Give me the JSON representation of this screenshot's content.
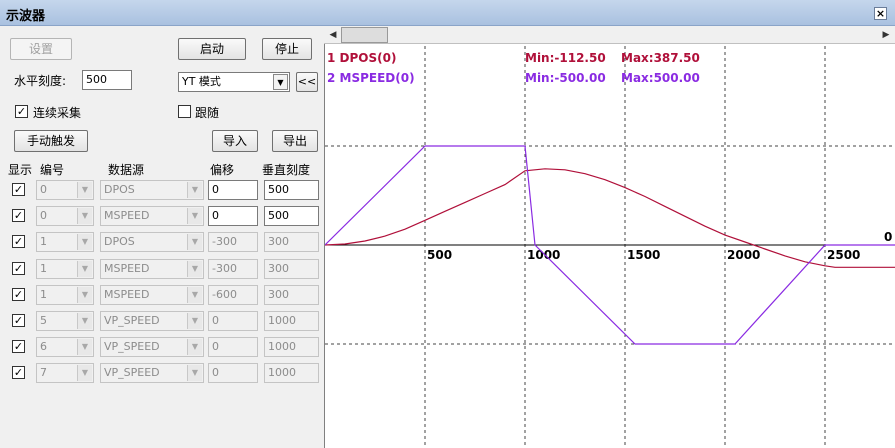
{
  "window": {
    "title": "示波器",
    "close_glyph": "×"
  },
  "controls": {
    "setup_label": "设置",
    "start_label": "启动",
    "stop_label": "停止",
    "hscale_label": "水平刻度:",
    "hscale_value": "500",
    "mode_value": "YT 模式",
    "collapse_label": "<<",
    "continuous_label": "连续采集",
    "continuous_checked": true,
    "follow_label": "跟随",
    "follow_checked": false,
    "manual_trigger_label": "手动触发",
    "import_label": "导入",
    "export_label": "导出"
  },
  "table": {
    "headers": {
      "show": "显示",
      "num": "编号",
      "source": "数据源",
      "offset": "偏移",
      "vscale": "垂直刻度"
    },
    "rows": [
      {
        "show": true,
        "num": "0",
        "source": "DPOS",
        "offset": "0",
        "vscale": "500",
        "enabled": true
      },
      {
        "show": true,
        "num": "0",
        "source": "MSPEED",
        "offset": "0",
        "vscale": "500",
        "enabled": true
      },
      {
        "show": true,
        "num": "1",
        "source": "DPOS",
        "offset": "-300",
        "vscale": "300",
        "enabled": false
      },
      {
        "show": true,
        "num": "1",
        "source": "MSPEED",
        "offset": "-300",
        "vscale": "300",
        "enabled": false
      },
      {
        "show": true,
        "num": "1",
        "source": "MSPEED",
        "offset": "-600",
        "vscale": "300",
        "enabled": false
      },
      {
        "show": true,
        "num": "5",
        "source": "VP_SPEED",
        "offset": "0",
        "vscale": "1000",
        "enabled": false
      },
      {
        "show": true,
        "num": "6",
        "source": "VP_SPEED",
        "offset": "0",
        "vscale": "1000",
        "enabled": false
      },
      {
        "show": true,
        "num": "7",
        "source": "VP_SPEED",
        "offset": "0",
        "vscale": "1000",
        "enabled": false
      }
    ]
  },
  "chart_data": {
    "type": "line",
    "x_ticks": [
      "500",
      "1000",
      "1500",
      "2000",
      "2500"
    ],
    "zero_label": "0",
    "xlim": [
      0,
      2850
    ],
    "ylim": [
      -500,
      500
    ],
    "grid": true,
    "legend": [
      {
        "label": "1 DPOS(0)",
        "min": "Min:-112.50",
        "max": "Max:387.50",
        "color": "#b0103a"
      },
      {
        "label": "2 MSPEED(0)",
        "min": "Min:-500.00",
        "max": "Max:500.00",
        "color": "#8a2be2"
      }
    ],
    "series": [
      {
        "name": "1 DPOS(0)",
        "color": "#b0103a",
        "x": [
          0,
          100,
          200,
          300,
          400,
          500,
          600,
          700,
          800,
          900,
          1000,
          1100,
          1200,
          1300,
          1400,
          1500,
          1600,
          1700,
          1800,
          1900,
          2000,
          2100,
          2200,
          2300,
          2400,
          2500,
          2550,
          2700,
          2850
        ],
        "y": [
          0,
          5,
          20,
          45,
          80,
          125,
          170,
          215,
          260,
          305,
          375,
          385,
          380,
          360,
          330,
          290,
          245,
          195,
          145,
          95,
          50,
          15,
          -20,
          -55,
          -85,
          -105,
          -112.5,
          -112.5,
          -112.5
        ]
      },
      {
        "name": "2 MSPEED(0)",
        "color": "#8a2be2",
        "x": [
          0,
          500,
          1000,
          1050,
          1550,
          2050,
          2500,
          2550,
          2850
        ],
        "y": [
          0,
          500,
          500,
          0,
          -500,
          -500,
          0,
          0,
          0
        ]
      }
    ]
  }
}
